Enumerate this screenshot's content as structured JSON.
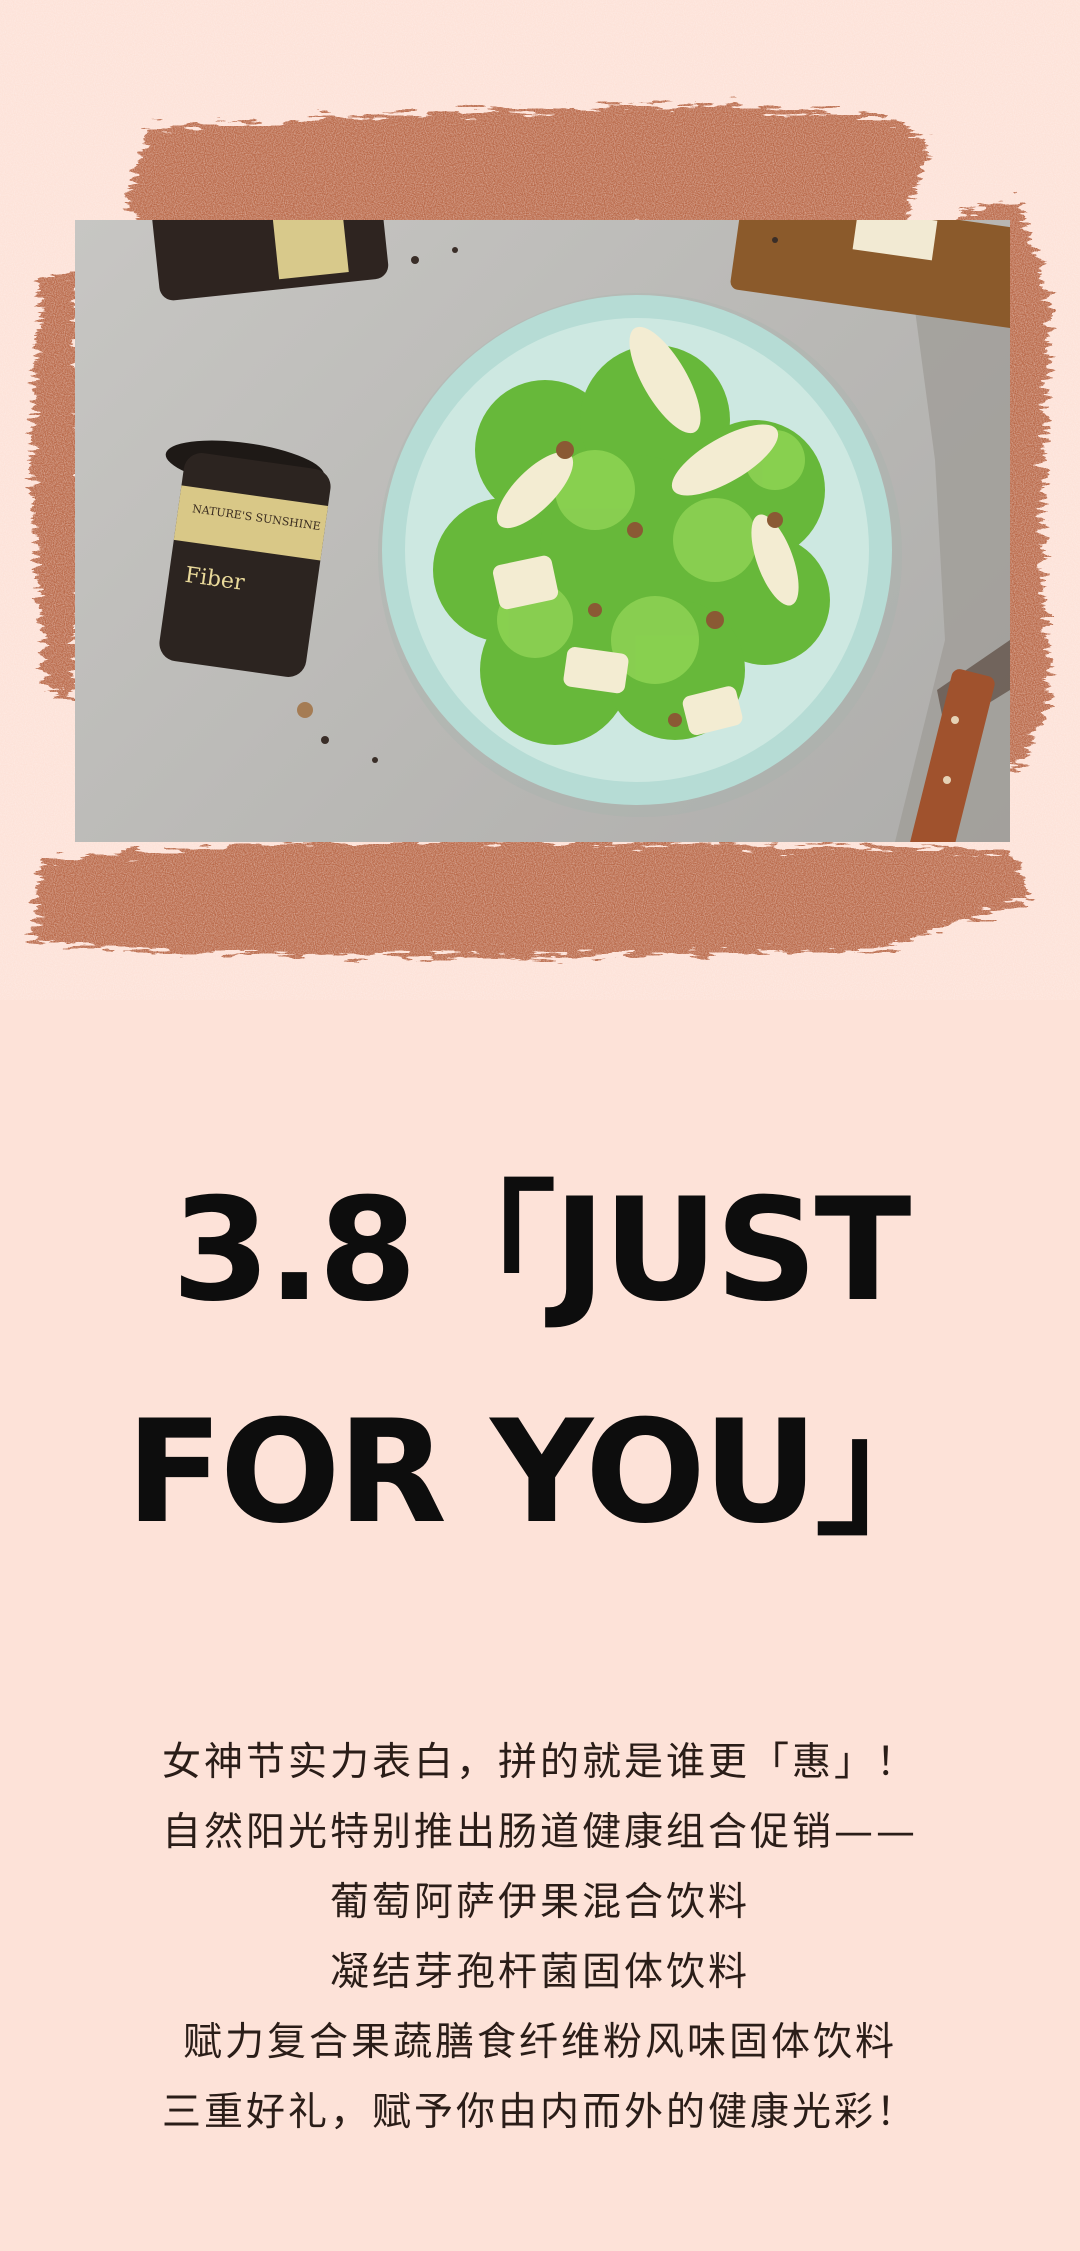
{
  "hero": {
    "jar_brand": "NATURE'S SUNSHINE",
    "jar_product": "Fiber"
  },
  "headline": {
    "line1": "3.8「JUST",
    "line2": "FOR YOU」"
  },
  "copy": {
    "lines": [
      "女神节实力表白，拼的就是谁更「惠」！",
      "自然阳光特别推出肠道健康组合促销——",
      "葡萄阿萨伊果混合饮料",
      "凝结芽孢杆菌固体饮料",
      "赋力复合果蔬膳食纤维粉风味固体饮料",
      "三重好礼，赋予你由内而外的健康光彩！"
    ]
  },
  "colors": {
    "background": "#fde2d8",
    "brush": "#b9694a",
    "headline": "#0d0d0d",
    "body_text": "#2a1d18"
  }
}
